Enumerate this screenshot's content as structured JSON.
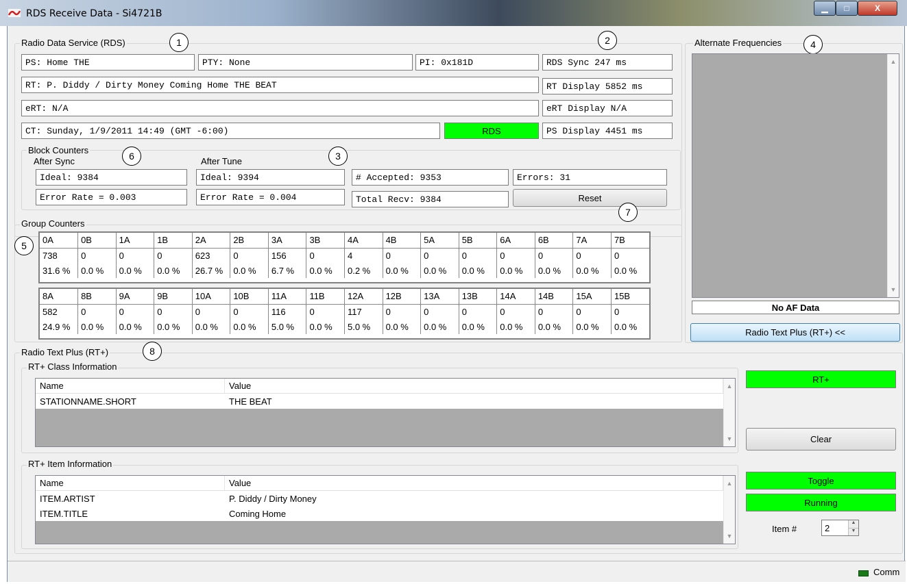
{
  "window": {
    "title": "RDS Receive Data - Si4721B",
    "min_label": "▁",
    "max_label": "□",
    "close_label": "X"
  },
  "rds": {
    "group_label": "Radio Data Service (RDS)",
    "ps": "PS: Home THE",
    "pty": "PTY: None",
    "pi": "PI: 0x181D",
    "rds_sync": "RDS Sync 247 ms",
    "rt": "RT: P. Diddy / Dirty Money Coming Home THE BEAT",
    "rt_display": "RT Display 5852 ms",
    "ert": "eRT: N/A",
    "ert_display": "eRT Display N/A",
    "ct": "CT: Sunday, 1/9/2011 14:49 (GMT -6:00)",
    "rds_indicator": "RDS",
    "ps_display": "PS Display 4451 ms"
  },
  "block_counters": {
    "group_label": "Block Counters",
    "after_sync_label": "After Sync",
    "after_tune_label": "After Tune",
    "sync_ideal": "Ideal: 9384",
    "sync_error_rate": "Error Rate = 0.003",
    "tune_ideal": "Ideal: 9394",
    "tune_error_rate": "Error Rate = 0.004",
    "accepted": "# Accepted: 9353",
    "errors": "Errors: 31",
    "total_recv": "Total Recv: 9384",
    "reset_label": "Reset"
  },
  "group_counters": {
    "group_label": "Group Counters",
    "table1": {
      "headers": [
        "0A",
        "0B",
        "1A",
        "1B",
        "2A",
        "2B",
        "3A",
        "3B",
        "4A",
        "4B",
        "5A",
        "5B",
        "6A",
        "6B",
        "7A",
        "7B"
      ],
      "counts": [
        "738",
        "0",
        "0",
        "0",
        "623",
        "0",
        "156",
        "0",
        "4",
        "0",
        "0",
        "0",
        "0",
        "0",
        "0",
        "0"
      ],
      "percents": [
        "31.6 %",
        "0.0 %",
        "0.0 %",
        "0.0 %",
        "26.7 %",
        "0.0 %",
        "6.7 %",
        "0.0 %",
        "0.2 %",
        "0.0 %",
        "0.0 %",
        "0.0 %",
        "0.0 %",
        "0.0 %",
        "0.0 %",
        "0.0 %"
      ]
    },
    "table2": {
      "headers": [
        "8A",
        "8B",
        "9A",
        "9B",
        "10A",
        "10B",
        "11A",
        "11B",
        "12A",
        "12B",
        "13A",
        "13B",
        "14A",
        "14B",
        "15A",
        "15B"
      ],
      "counts": [
        "582",
        "0",
        "0",
        "0",
        "0",
        "0",
        "116",
        "0",
        "117",
        "0",
        "0",
        "0",
        "0",
        "0",
        "0",
        "0"
      ],
      "percents": [
        "24.9 %",
        "0.0 %",
        "0.0 %",
        "0.0 %",
        "0.0 %",
        "0.0 %",
        "5.0 %",
        "0.0 %",
        "5.0 %",
        "0.0 %",
        "0.0 %",
        "0.0 %",
        "0.0 %",
        "0.0 %",
        "0.0 %",
        "0.0 %"
      ]
    }
  },
  "af": {
    "group_label": "Alternate Frequencies",
    "status": "No AF Data",
    "rtplus_button": "Radio Text Plus (RT+)  <<"
  },
  "rtplus": {
    "group_label": "Radio Text Plus (RT+)",
    "class_label": "RT+ Class Information",
    "item_label": "RT+ Item Information",
    "col_name": "Name",
    "col_value": "Value",
    "class_rows": [
      {
        "name": "STATIONNAME.SHORT",
        "value": "THE BEAT"
      }
    ],
    "item_rows": [
      {
        "name": "ITEM.ARTIST",
        "value": "P. Diddy / Dirty Money"
      },
      {
        "name": "ITEM.TITLE",
        "value": "Coming Home"
      }
    ],
    "rtplus_indicator": "RT+",
    "clear_label": "Clear",
    "toggle_indicator": "Toggle",
    "running_indicator": "Running",
    "item_num_label": "Item #",
    "item_num_value": "2"
  },
  "callouts": [
    "1",
    "2",
    "3",
    "4",
    "5",
    "6",
    "7",
    "8"
  ],
  "status_bar": {
    "comm_label": "Comm"
  },
  "colors": {
    "indicator_green": "#00ff00",
    "comm_led": "#1a7a1a"
  }
}
